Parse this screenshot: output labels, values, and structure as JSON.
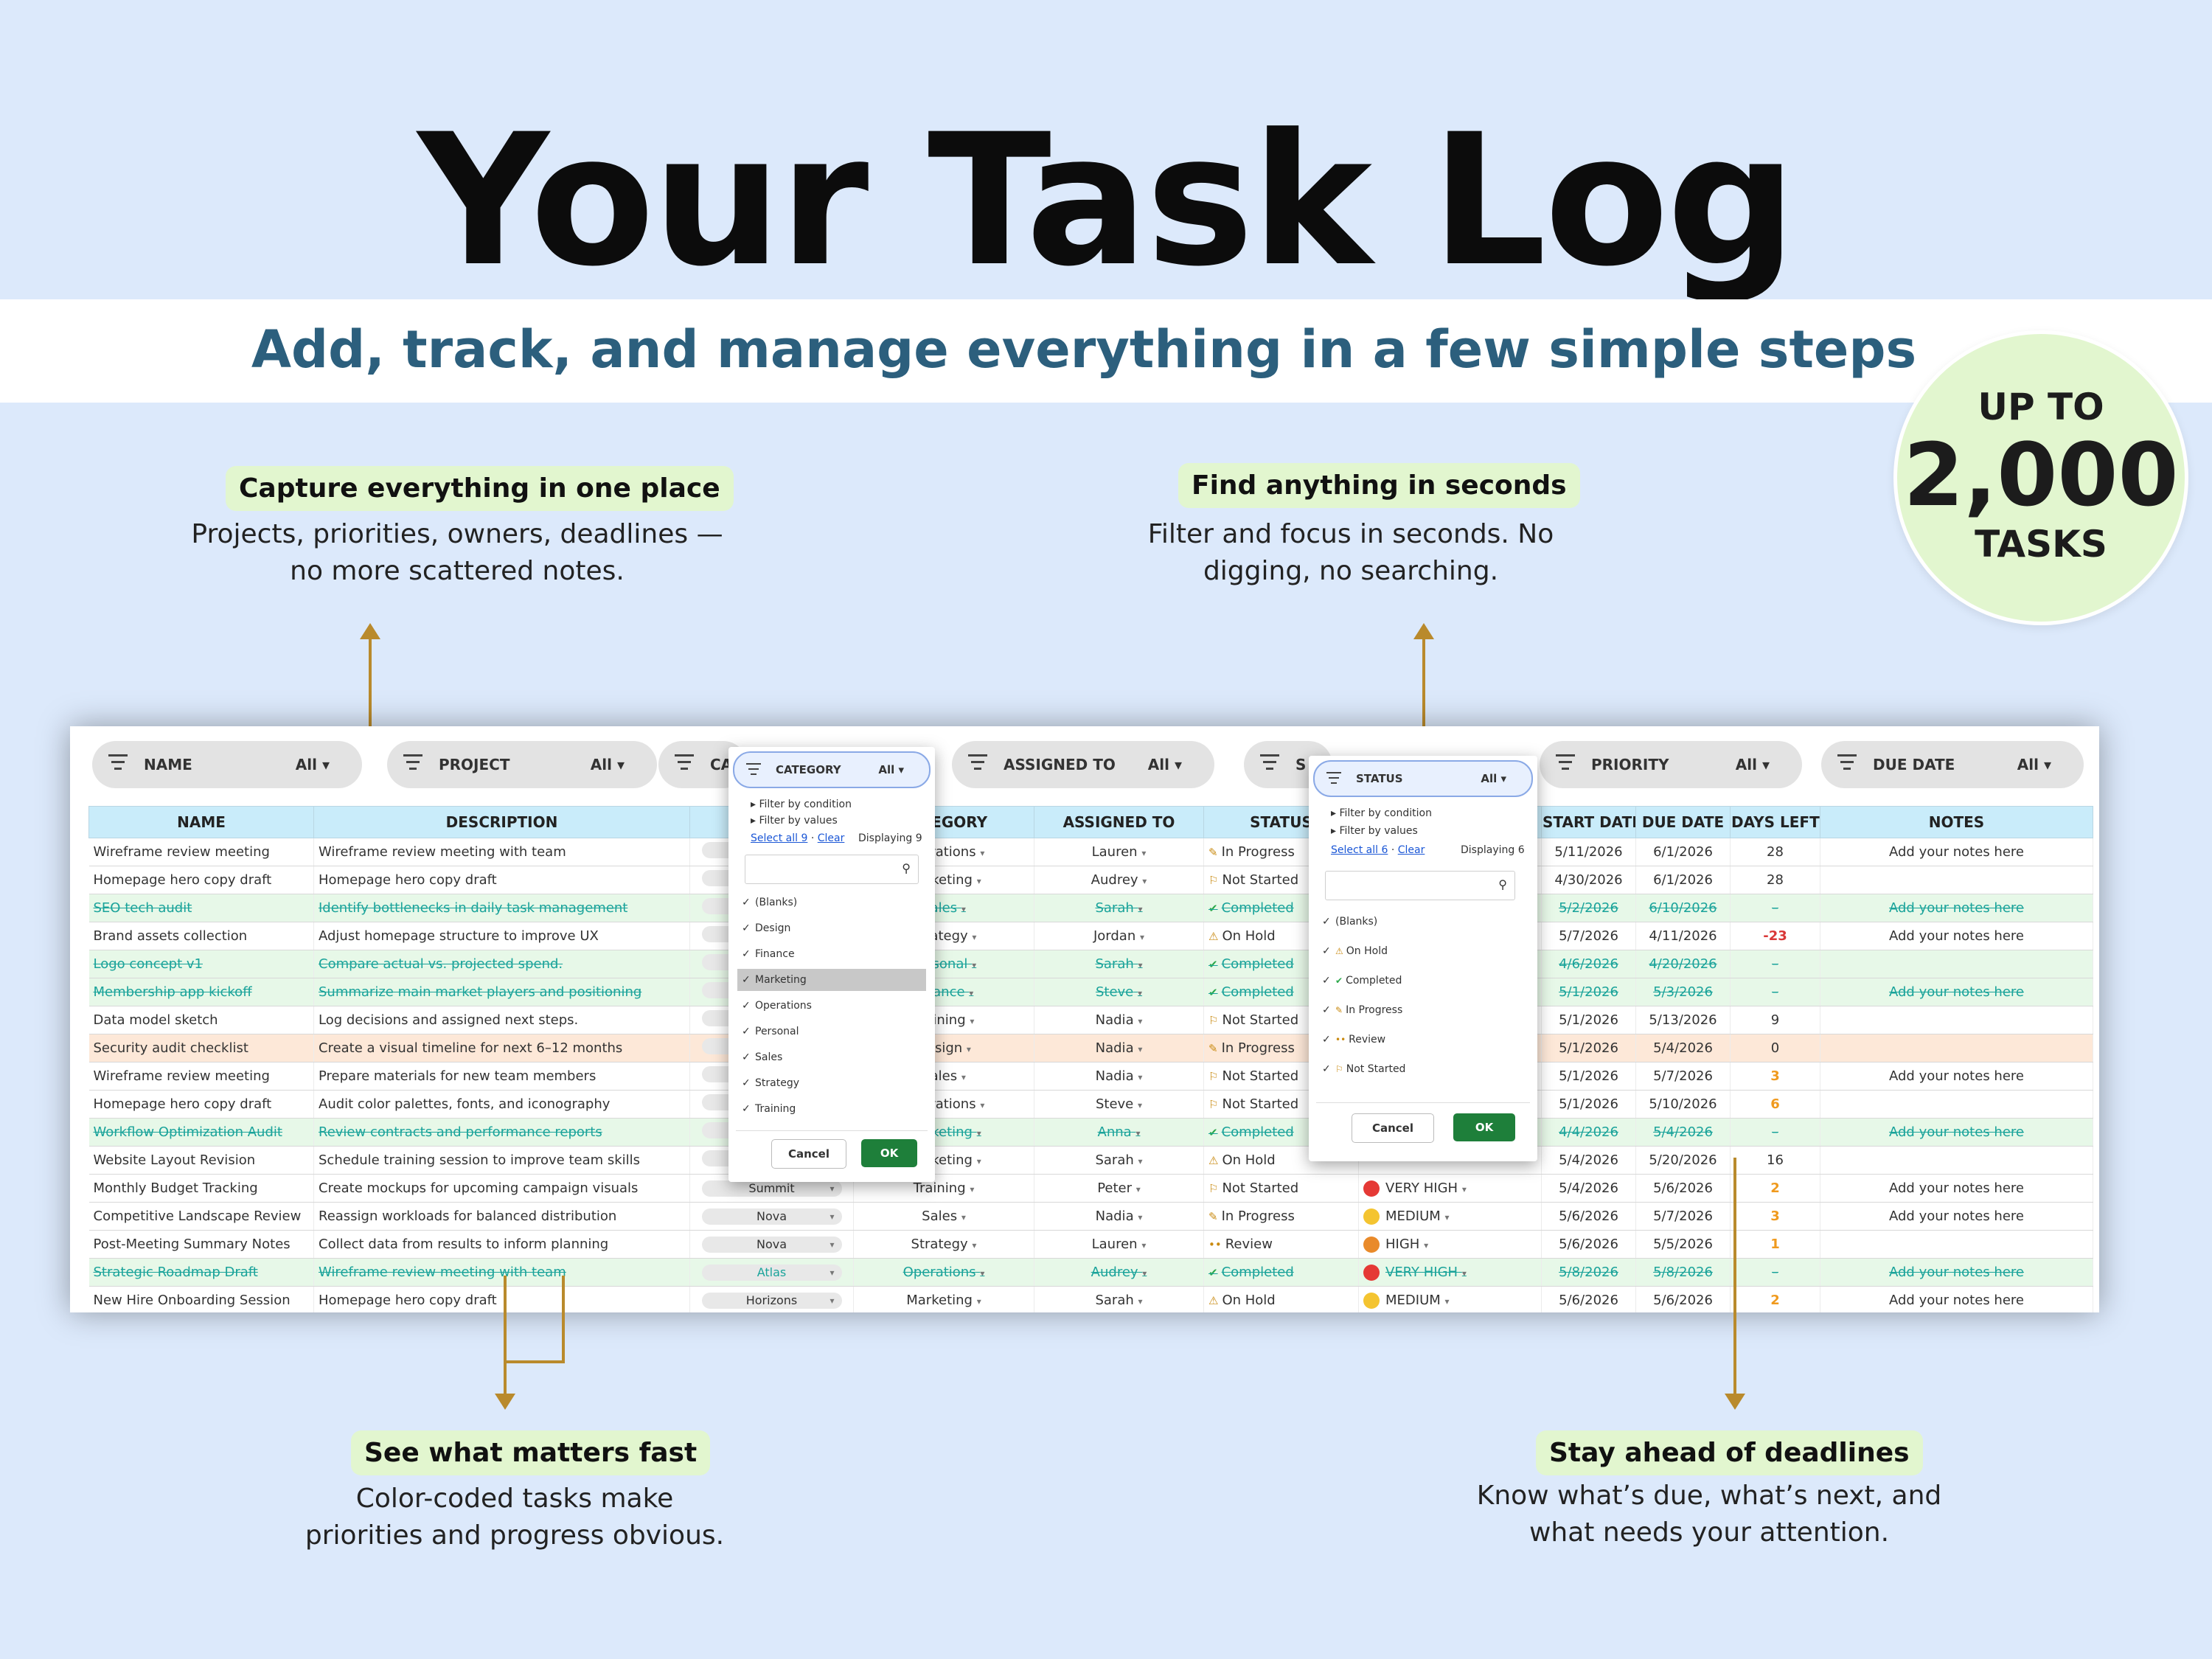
{
  "title": "Your Task Log",
  "subtitle": "Add, track, and manage everything in a few simple steps",
  "badge": {
    "line1": "UP TO",
    "line2": "2,000",
    "line3": "TASKS"
  },
  "callouts": {
    "capture": {
      "title": "Capture everything in one place",
      "text1": "Projects, priorities, owners, deadlines —",
      "text2": "no more scattered notes."
    },
    "find": {
      "title": "Find anything in seconds",
      "text1": "Filter and focus in seconds. No",
      "text2": "digging, no searching."
    },
    "see": {
      "title": "See what matters fast",
      "text1": "Color-coded tasks make",
      "text2": "priorities and progress obvious."
    },
    "stay": {
      "title": "Stay ahead of deadlines",
      "text1": "Know what’s due, what’s next, and",
      "text2": "what needs your attention."
    }
  },
  "filters": [
    {
      "name": "NAME",
      "value": "All ▾"
    },
    {
      "name": "PROJECT",
      "value": "All ▾"
    },
    {
      "name": "CA",
      "value": ""
    },
    {
      "name": "ASSIGNED TO",
      "value": "All ▾"
    },
    {
      "name": "S",
      "value": ""
    },
    {
      "name": "PRIORITY",
      "value": "All ▾"
    },
    {
      "name": "DUE DATE",
      "value": "All ▾"
    }
  ],
  "columns": [
    "NAME",
    "DESCRIPTION",
    "",
    "CATEGORY",
    "ASSIGNED TO",
    "STATUS",
    "START DATE",
    "DUE DATE",
    "DAYS LEFT",
    "NOTES"
  ],
  "rows": [
    {
      "name": "Wireframe review meeting",
      "desc": "Wireframe review meeting with team",
      "proj": "",
      "cat": "Operations",
      "who": "Lauren",
      "status": "In Progress",
      "pri": "",
      "start": "5/11/2026",
      "due": "6/1/2026",
      "days": "28",
      "notes": "Add your notes here"
    },
    {
      "name": "Homepage hero copy draft",
      "desc": "Homepage hero copy draft",
      "proj": "",
      "cat": "Marketing",
      "who": "Audrey",
      "status": "Not Started",
      "pri": "",
      "start": "4/30/2026",
      "due": "6/1/2026",
      "days": "28",
      "notes": ""
    },
    {
      "name": "SEO tech audit",
      "desc": "Identify bottlenecks in daily task management",
      "proj": "",
      "cat": "Sales",
      "who": "Sarah",
      "status": "Completed",
      "pri": "",
      "start": "5/2/2026",
      "due": "6/10/2026",
      "days": "–",
      "notes": "Add your notes here"
    },
    {
      "name": "Brand assets collection",
      "desc": "Adjust homepage structure to improve UX",
      "proj": "",
      "cat": "Strategy",
      "who": "Jordan",
      "status": "On Hold",
      "pri": "",
      "start": "5/7/2026",
      "due": "4/11/2026",
      "days": "-23",
      "notes": "Add your notes here"
    },
    {
      "name": "Logo concept v1",
      "desc": "Compare actual vs. projected spend.",
      "proj": "",
      "cat": "Personal",
      "who": "Sarah",
      "status": "Completed",
      "pri": "",
      "start": "4/6/2026",
      "due": "4/20/2026",
      "days": "–",
      "notes": ""
    },
    {
      "name": "Membership app kickoff",
      "desc": "Summarize main market players and positioning",
      "proj": "",
      "cat": "Finance",
      "who": "Steve",
      "status": "Completed",
      "pri": "",
      "start": "5/1/2026",
      "due": "5/3/2026",
      "days": "–",
      "notes": "Add your notes here"
    },
    {
      "name": "Data model sketch",
      "desc": "Log decisions and assigned next steps.",
      "proj": "",
      "cat": "Training",
      "who": "Nadia",
      "status": "Not Started",
      "pri": "",
      "start": "5/1/2026",
      "due": "5/13/2026",
      "days": "9",
      "notes": ""
    },
    {
      "name": "Security audit checklist",
      "desc": "Create a visual timeline for next 6–12 months",
      "proj": "",
      "cat": "Design",
      "who": "Nadia",
      "status": "In Progress",
      "pri": "",
      "start": "5/1/2026",
      "due": "5/4/2026",
      "days": "0",
      "notes": ""
    },
    {
      "name": "Wireframe review meeting",
      "desc": "Prepare materials for new team members",
      "proj": "",
      "cat": "Sales",
      "who": "Nadia",
      "status": "Not Started",
      "pri": "",
      "start": "5/1/2026",
      "due": "5/7/2026",
      "days": "3",
      "notes": "Add your notes here"
    },
    {
      "name": "Homepage hero copy draft",
      "desc": "Audit color palettes, fonts, and iconography",
      "proj": "",
      "cat": "Operations",
      "who": "Steve",
      "status": "Not Started",
      "pri": "",
      "start": "5/1/2026",
      "due": "5/10/2026",
      "days": "6",
      "notes": ""
    },
    {
      "name": "Workflow Optimization Audit",
      "desc": "Review contracts and performance reports",
      "proj": "",
      "cat": "Marketing",
      "who": "Anna",
      "status": "Completed",
      "pri": "",
      "start": "4/4/2026",
      "due": "5/4/2026",
      "days": "–",
      "notes": "Add your notes here"
    },
    {
      "name": "Website Layout Revision",
      "desc": "Schedule training session to improve team skills",
      "proj": "",
      "cat": "Marketing",
      "who": "Sarah",
      "status": "On Hold",
      "pri": "",
      "start": "5/4/2026",
      "due": "5/20/2026",
      "days": "16",
      "notes": ""
    },
    {
      "name": "Monthly Budget Tracking",
      "desc": "Create mockups for upcoming campaign visuals",
      "proj": "Summit",
      "cat": "Training",
      "who": "Peter",
      "status": "Not Started",
      "pri": "VERY HIGH",
      "start": "5/4/2026",
      "due": "5/6/2026",
      "days": "2",
      "notes": "Add your notes here"
    },
    {
      "name": "Competitive Landscape Review",
      "desc": "Reassign workloads for balanced distribution",
      "proj": "Nova",
      "cat": "Sales",
      "who": "Nadia",
      "status": "In Progress",
      "pri": "MEDIUM",
      "start": "5/6/2026",
      "due": "5/7/2026",
      "days": "3",
      "notes": "Add your notes here"
    },
    {
      "name": "Post-Meeting Summary Notes",
      "desc": "Collect data from results to inform planning",
      "proj": "Nova",
      "cat": "Strategy",
      "who": "Lauren",
      "status": "Review",
      "pri": "HIGH",
      "start": "5/6/2026",
      "due": "5/5/2026",
      "days": "1",
      "notes": ""
    },
    {
      "name": "Strategic Roadmap Draft",
      "desc": "Wireframe review meeting with team",
      "proj": "Atlas",
      "cat": "Operations",
      "who": "Audrey",
      "status": "Completed",
      "pri": "VERY HIGH",
      "start": "5/8/2026",
      "due": "5/8/2026",
      "days": "–",
      "notes": "Add your notes here"
    },
    {
      "name": "New Hire Onboarding Session",
      "desc": "Homepage hero copy draft",
      "proj": "Horizons",
      "cat": "Marketing",
      "who": "Sarah",
      "status": "On Hold",
      "pri": "MEDIUM",
      "start": "5/6/2026",
      "due": "5/6/2026",
      "days": "2",
      "notes": "Add your notes here"
    }
  ],
  "category_popup": {
    "header": "CATEGORY",
    "header_value": "All ▾",
    "filter_condition": "Filter by condition",
    "filter_values": "Filter by values",
    "select_all": "Select all 9",
    "sep": "·",
    "clear": "Clear",
    "displaying": "Displaying 9",
    "options": [
      "(Blanks)",
      "Design",
      "Finance",
      "Marketing",
      "Operations",
      "Personal",
      "Sales",
      "Strategy",
      "Training"
    ],
    "selected": "Marketing",
    "cancel": "Cancel",
    "ok": "OK"
  },
  "status_popup": {
    "header": "STATUS",
    "header_value": "All ▾",
    "filter_condition": "Filter by condition",
    "filter_values": "Filter by values",
    "select_all": "Select all 6",
    "sep": "·",
    "clear": "Clear",
    "displaying": "Displaying 6",
    "options": [
      "(Blanks)",
      "On Hold",
      "Completed",
      "In Progress",
      "Review",
      "Not Started"
    ],
    "cancel": "Cancel",
    "ok": "OK"
  },
  "colors": {
    "accent_green": "#1e7f3a",
    "completed_text": "#1aa39a",
    "header_blue": "#c9ecfa",
    "subtitle": "#2c5f7d",
    "arrow": "#b98a2c",
    "pill_green": "#e2f6cf"
  }
}
